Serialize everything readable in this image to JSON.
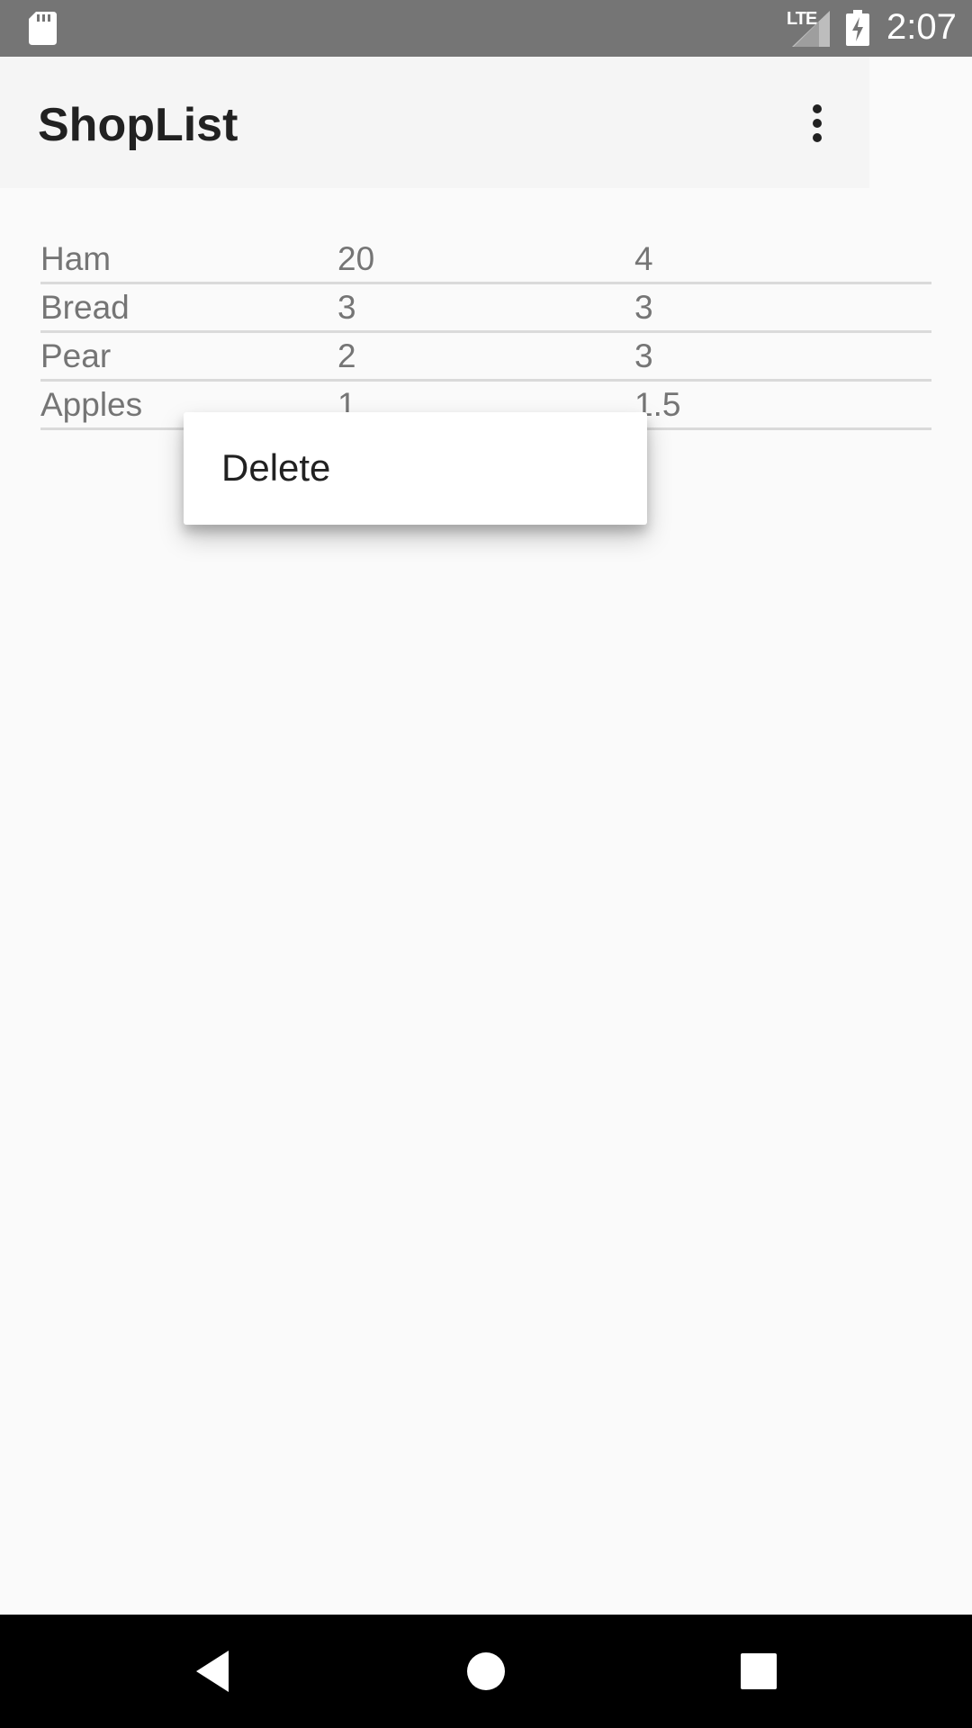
{
  "status_bar": {
    "network": "LTE",
    "time": "2:07",
    "icons": [
      "sd-card-icon",
      "signal-icon",
      "battery-charging-icon"
    ]
  },
  "app_bar": {
    "title": "ShopList",
    "menu_icon": "more-vert-icon"
  },
  "list": {
    "rows": [
      {
        "name": "Ham",
        "qty": "20",
        "price": "4"
      },
      {
        "name": "Bread",
        "qty": "3",
        "price": "3"
      },
      {
        "name": "Pear",
        "qty": "2",
        "price": "3"
      },
      {
        "name": "Apples",
        "qty": "1",
        "price": "1.5"
      }
    ]
  },
  "context_menu": {
    "items": [
      {
        "label": "Delete"
      }
    ]
  },
  "nav_bar": {
    "icons": [
      "back-icon",
      "home-icon",
      "recents-icon"
    ]
  },
  "colors": {
    "status_bar": "#757575",
    "app_bar": "#f5f5f5",
    "background": "#fafafa",
    "text_primary": "#212121",
    "text_secondary": "#757575",
    "nav_bar": "#000000"
  }
}
